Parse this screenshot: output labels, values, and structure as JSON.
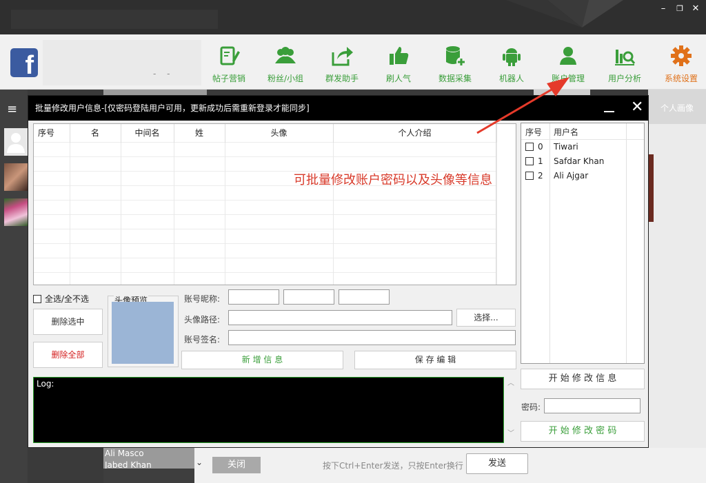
{
  "toolbar": {
    "items": [
      {
        "label": "帖子营销",
        "icon": "edit-icon"
      },
      {
        "label": "粉丝/小组",
        "icon": "users-icon"
      },
      {
        "label": "群发助手",
        "icon": "share-icon"
      },
      {
        "label": "刷人气",
        "icon": "thumbs-up-icon"
      },
      {
        "label": "数据采集",
        "icon": "database-add-icon"
      },
      {
        "label": "机器人",
        "icon": "android-icon"
      },
      {
        "label": "账户管理",
        "icon": "user-icon"
      },
      {
        "label": "用户分析",
        "icon": "analytics-icon"
      },
      {
        "label": "系统设置",
        "icon": "gear-icon"
      }
    ],
    "search_hint": "- -",
    "accent": "#3a9e3a",
    "active_color": "#e0711a"
  },
  "window": {
    "minimize": "–",
    "restore": "❐",
    "close": "✕"
  },
  "background": {
    "right_header": "个人画像",
    "bottom_list": [
      "Ali Masco",
      "Jabed Khan"
    ],
    "close_label": "关闭",
    "hint": "按下Ctrl+Enter发送，只按Enter换行",
    "send_label": "发送"
  },
  "dialog": {
    "title": "批量修改用户信息-[仅密码登陆用户可用，更新成功后需重新登录才能同步]",
    "table": {
      "columns": [
        "序号",
        "名",
        "中间名",
        "姓",
        "头像",
        "个人介绍"
      ]
    },
    "annotation": "可批量修改账户密码以及头像等信息",
    "select_all": "全选/全不选",
    "delete_selected": "删除选中",
    "delete_all": "删除全部",
    "preview_label": "头像预览",
    "nickname_label": "账号昵称:",
    "avatar_path_label": "头像路径:",
    "choose_button": "选择...",
    "signature_label": "账号签名:",
    "add_button": "新 增 信 息",
    "save_button": "保 存 编 辑",
    "log_text": "Log:",
    "accounts": {
      "columns": [
        "序号",
        "用户名"
      ],
      "rows": [
        {
          "index": "0",
          "name": "Tiwari"
        },
        {
          "index": "1",
          "name": "Safdar Khan"
        },
        {
          "index": "2",
          "name": "Ali Ajgar"
        }
      ]
    },
    "start_modify_info": "开 始 修 改 信 息",
    "password_label": "密码:",
    "start_modify_password": "开 始 修 改 密 码"
  }
}
